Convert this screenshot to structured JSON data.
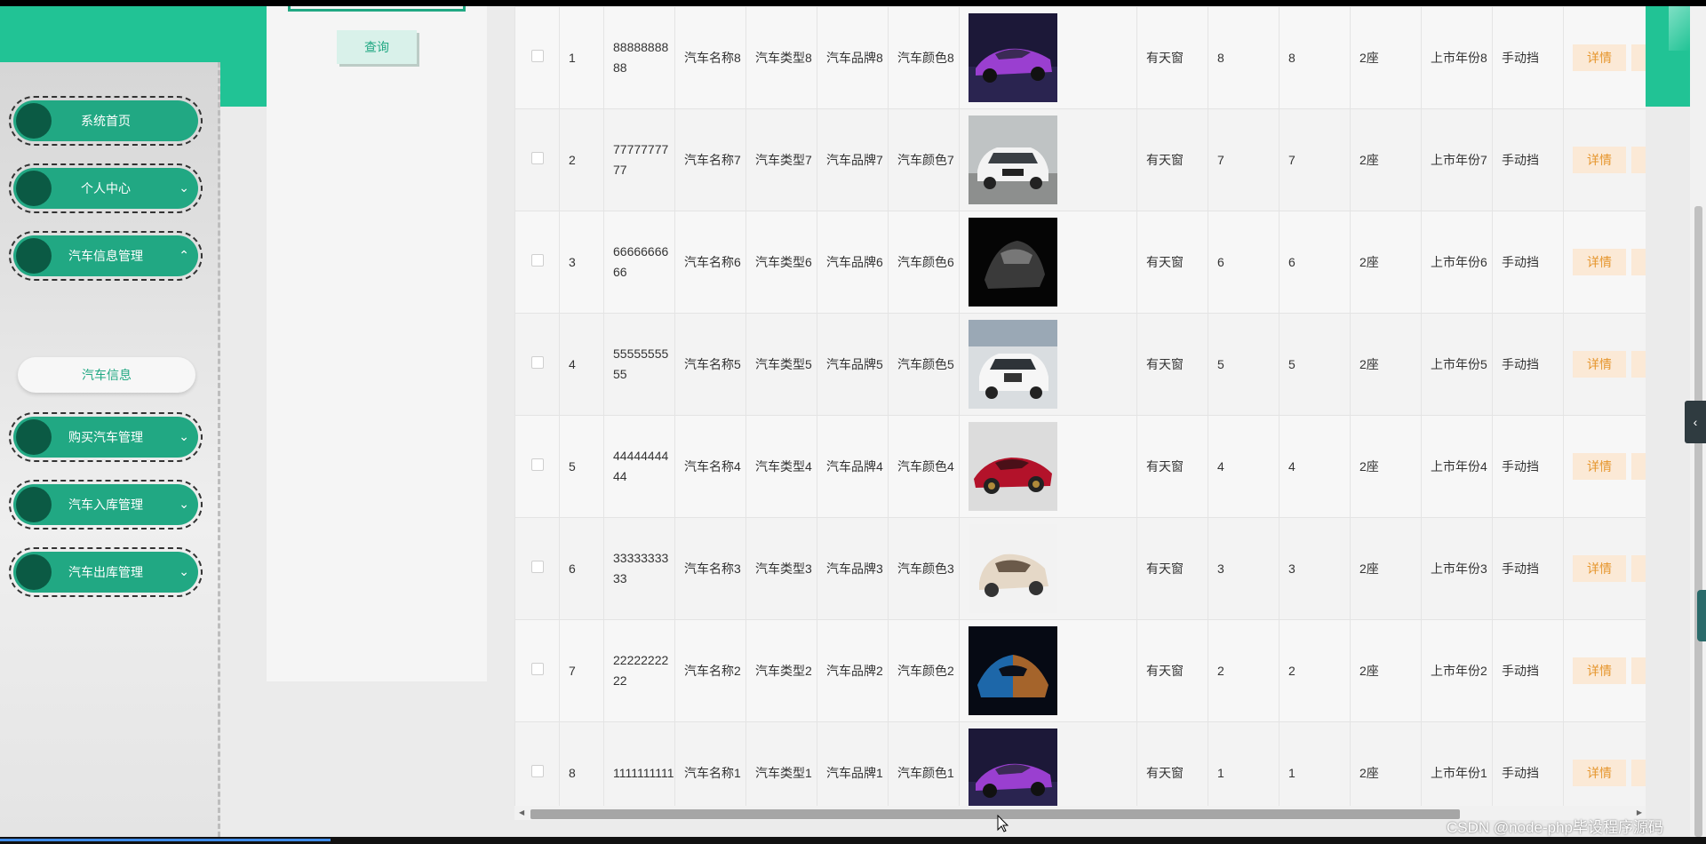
{
  "sidebar": {
    "items": [
      {
        "label": "系统首页",
        "chevron": ""
      },
      {
        "label": "个人中心",
        "chevron": "⌄"
      },
      {
        "label": "汽车信息管理",
        "chevron": "⌃"
      },
      {
        "label": "购买汽车管理",
        "chevron": "⌄"
      },
      {
        "label": "汽车入库管理",
        "chevron": "⌄"
      },
      {
        "label": "汽车出库管理",
        "chevron": "⌄"
      }
    ],
    "sub_item": "汽车信息"
  },
  "search": {
    "query_label": "查询"
  },
  "table": {
    "detail_label": "详情",
    "rows": [
      {
        "idx": "1",
        "code": "8888888888",
        "name": "汽车名称8",
        "type": "汽车类型8",
        "brand": "汽车品牌8",
        "color": "汽车颜色8",
        "image": "purple-sports-car",
        "sunroof": "有天窗",
        "v1": "8",
        "v2": "8",
        "seats": "2座",
        "year": "上市年份8",
        "gear": "手动挡"
      },
      {
        "idx": "2",
        "code": "7777777777",
        "name": "汽车名称7",
        "type": "汽车类型7",
        "brand": "汽车品牌7",
        "color": "汽车颜色7",
        "image": "white-suv",
        "sunroof": "有天窗",
        "v1": "7",
        "v2": "7",
        "seats": "2座",
        "year": "上市年份7",
        "gear": "手动挡"
      },
      {
        "idx": "3",
        "code": "6666666666",
        "name": "汽车名称6",
        "type": "汽车类型6",
        "brand": "汽车品牌6",
        "color": "汽车颜色6",
        "image": "dark-car",
        "sunroof": "有天窗",
        "v1": "6",
        "v2": "6",
        "seats": "2座",
        "year": "上市年份6",
        "gear": "手动挡"
      },
      {
        "idx": "4",
        "code": "5555555555",
        "name": "汽车名称5",
        "type": "汽车类型5",
        "brand": "汽车品牌5",
        "color": "汽车颜色5",
        "image": "white-bmw-suv",
        "sunroof": "有天窗",
        "v1": "5",
        "v2": "5",
        "seats": "2座",
        "year": "上市年份5",
        "gear": "手动挡"
      },
      {
        "idx": "5",
        "code": "4444444444",
        "name": "汽车名称4",
        "type": "汽车类型4",
        "brand": "汽车品牌4",
        "color": "汽车颜色4",
        "image": "red-sports-car",
        "sunroof": "有天窗",
        "v1": "4",
        "v2": "4",
        "seats": "2座",
        "year": "上市年份4",
        "gear": "手动挡"
      },
      {
        "idx": "6",
        "code": "3333333333",
        "name": "汽车名称3",
        "type": "汽车类型3",
        "brand": "汽车品牌3",
        "color": "汽车颜色3",
        "image": "beige-concept-car",
        "sunroof": "有天窗",
        "v1": "3",
        "v2": "3",
        "seats": "2座",
        "year": "上市年份3",
        "gear": "手动挡"
      },
      {
        "idx": "7",
        "code": "2222222222",
        "name": "汽车名称2",
        "type": "汽车类型2",
        "brand": "汽车品牌2",
        "color": "汽车颜色2",
        "image": "neon-car",
        "sunroof": "有天窗",
        "v1": "2",
        "v2": "2",
        "seats": "2座",
        "year": "上市年份2",
        "gear": "手动挡"
      },
      {
        "idx": "8",
        "code": "1111111111",
        "name": "汽车名称1",
        "type": "汽车类型1",
        "brand": "汽车品牌1",
        "color": "汽车颜色1",
        "image": "purple-sports-car",
        "sunroof": "有天窗",
        "v1": "1",
        "v2": "1",
        "seats": "2座",
        "year": "上市年份1",
        "gear": "手动挡"
      }
    ]
  },
  "watermark": "CSDN @node-php毕设程序源码",
  "colors": {
    "accent": "#21c395",
    "nav_pill": "#21a883",
    "nav_circle": "#0b5a44",
    "detail_text": "#e6962e",
    "detail_bg": "#fbe9d6"
  }
}
